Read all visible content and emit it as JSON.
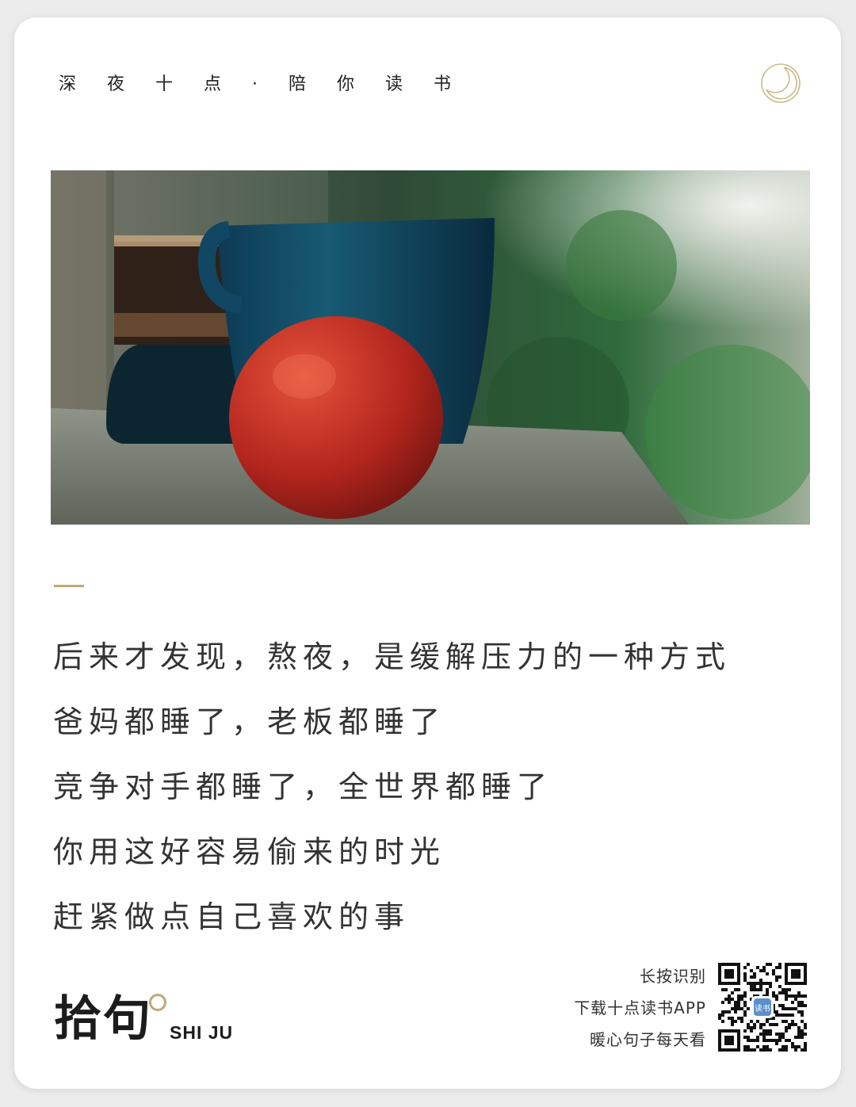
{
  "header": {
    "tagline": "深夜十点·陪你读书",
    "icon": "crescent-moon-icon"
  },
  "photo": {
    "alt": "photo-coffee-mug-and-apple"
  },
  "quote": {
    "lines": [
      "后来才发现，熬夜，是缓解压力的一种方式",
      "爸妈都睡了，老板都睡了",
      "竞争对手都睡了，全世界都睡了",
      "你用这好容易偷来的时光",
      "赶紧做点自己喜欢的事"
    ]
  },
  "footer": {
    "logo_cn": "拾句",
    "logo_en": "SHI JU",
    "qr_lines": [
      "长按识别",
      "下载十点读书APP",
      "暖心句子每天看"
    ],
    "qr_center_text": "读书"
  },
  "colors": {
    "accent": "#bfa97a",
    "text": "#333333",
    "card": "#ffffff"
  }
}
